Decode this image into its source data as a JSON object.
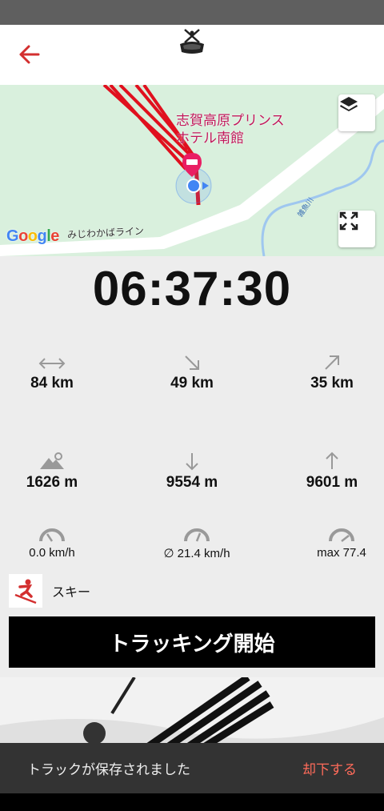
{
  "header": {
    "back_icon": "arrow-left-icon",
    "logo_icon": "skier-goggles-logo",
    "accent_color": "#d32f2f"
  },
  "map": {
    "place_label": "志賀高原プリンスホテル南館",
    "road_label": "みじわかばライン",
    "river_label": "雑魚川",
    "attribution": "Google",
    "layers_icon": "layers-icon",
    "fullscreen_icon": "fullscreen-icon"
  },
  "timer": "06:37:30",
  "stats": {
    "distance": {
      "icon": "horizontal-arrows-icon",
      "value": "84 km"
    },
    "downhill_distance": {
      "icon": "arrow-down-right-icon",
      "value": "49 km"
    },
    "uphill_distance": {
      "icon": "arrow-up-right-icon",
      "value": "35 km"
    },
    "altitude": {
      "icon": "mountain-pin-icon",
      "value": "1626 m"
    },
    "descent": {
      "icon": "arrow-down-icon",
      "value": "9554 m"
    },
    "ascent": {
      "icon": "arrow-up-icon",
      "value": "9601 m"
    },
    "current_speed": {
      "icon": "speedometer-icon",
      "value": "0.0 km/h"
    },
    "avg_speed": {
      "icon": "speedometer-icon",
      "value": "∅ 21.4 km/h"
    },
    "max_speed": {
      "icon": "speedometer-icon",
      "value": "max 77.4"
    }
  },
  "sport": {
    "icon": "skier-icon",
    "label": "スキー"
  },
  "start_button": "トラッキング開始",
  "snackbar": {
    "message": "トラックが保存されました",
    "action": "却下する",
    "action_color": "#ff6b5a"
  }
}
